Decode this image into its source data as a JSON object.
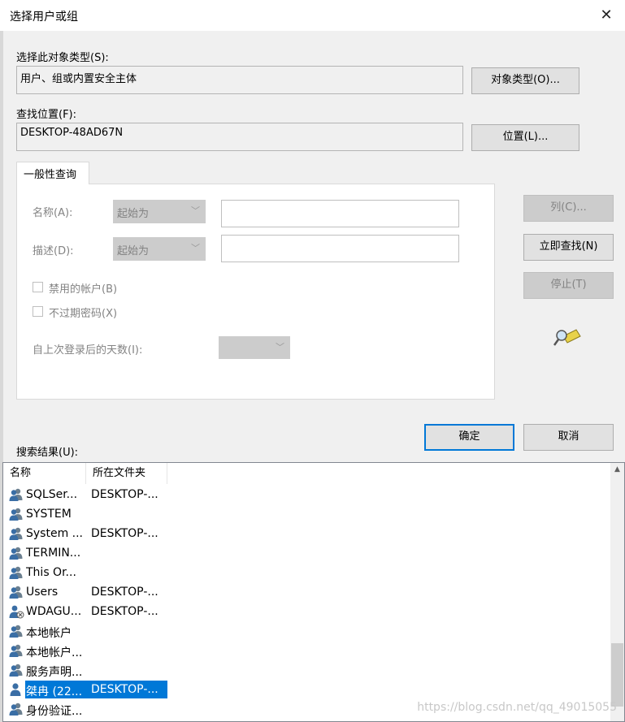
{
  "window": {
    "title": "选择用户或组",
    "close_glyph": "✕"
  },
  "object_type": {
    "label": "选择此对象类型(S):",
    "value": "用户、组或内置安全主体",
    "button": "对象类型(O)..."
  },
  "location": {
    "label": "查找位置(F):",
    "value": "DESKTOP-48AD67N",
    "button": "位置(L)..."
  },
  "query": {
    "tab": "一般性查询",
    "name_label": "名称(A):",
    "name_mode": "起始为",
    "desc_label": "描述(D):",
    "desc_mode": "起始为",
    "disabled_accounts": "禁用的帐户(B)",
    "non_expiring_pw": "不过期密码(X)",
    "days_label": "自上次登录后的天数(I):"
  },
  "side_buttons": {
    "columns": "列(C)...",
    "find_now": "立即查找(N)",
    "stop": "停止(T)"
  },
  "actions": {
    "ok": "确定",
    "cancel": "取消"
  },
  "results": {
    "label": "搜索结果(U):",
    "columns": [
      "名称",
      "所在文件夹"
    ],
    "rows": [
      {
        "name": "SQLSer...",
        "folder": "DESKTOP-...",
        "icon": "group-icon"
      },
      {
        "name": "SYSTEM",
        "folder": "",
        "icon": "group-icon"
      },
      {
        "name": "System ...",
        "folder": "DESKTOP-...",
        "icon": "group-icon"
      },
      {
        "name": "TERMIN...",
        "folder": "",
        "icon": "group-icon"
      },
      {
        "name": "This Or...",
        "folder": "",
        "icon": "group-icon"
      },
      {
        "name": "Users",
        "folder": "DESKTOP-...",
        "icon": "group-icon"
      },
      {
        "name": "WDAGU...",
        "folder": "DESKTOP-...",
        "icon": "user-disabled-icon"
      },
      {
        "name": "本地帐户",
        "folder": "",
        "icon": "group-icon"
      },
      {
        "name": "本地帐户...",
        "folder": "",
        "icon": "group-icon"
      },
      {
        "name": "服务声明...",
        "folder": "",
        "icon": "group-icon"
      },
      {
        "name": "桀冉 (22...",
        "folder": "DESKTOP-...",
        "icon": "user-icon",
        "selected": true
      },
      {
        "name": "身份验证...",
        "folder": "",
        "icon": "group-icon"
      }
    ]
  },
  "watermark": "https://blog.csdn.net/qq_49015055"
}
